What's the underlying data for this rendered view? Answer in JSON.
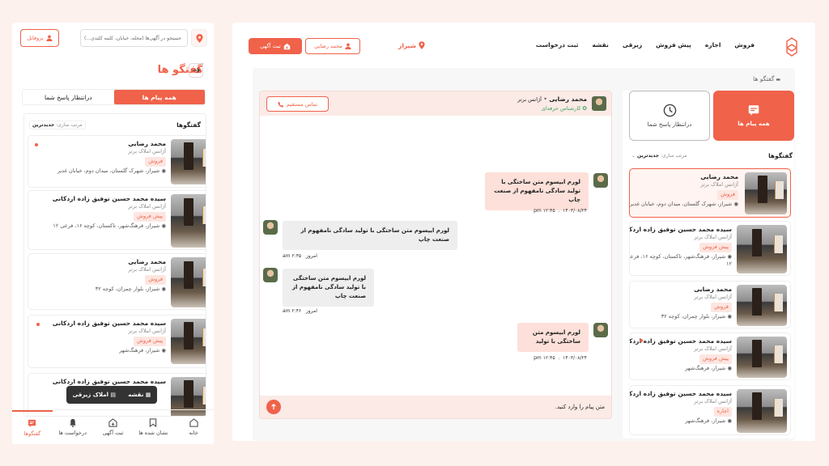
{
  "colors": {
    "accent": "#f0624a",
    "accent_soft": "#fde6e1"
  },
  "mobile": {
    "search_placeholder": "جستجو در آگهی‌ها (محله، خیابان، کلمه کلیدی...)",
    "profile_label": "پروفایل",
    "title": "گفتگو ها",
    "tabs": [
      {
        "label": "همه پیام ها"
      },
      {
        "label": "درانتظار پاسخ شما"
      }
    ],
    "list_title": "گفتگوها",
    "sort_label": "مرتب سازی:",
    "sort_value": "جدیدترین",
    "float_map": "نقشه",
    "float_zibaghi": "املاک زیرقی",
    "nav": [
      {
        "label": "خانه",
        "icon": "home-icon"
      },
      {
        "label": "نشان شده ها",
        "icon": "bookmark-icon"
      },
      {
        "label": "ثبت آگهی",
        "icon": "add-home-icon"
      },
      {
        "label": "درخواست ها",
        "icon": "bell-icon"
      },
      {
        "label": "گفتگوها",
        "icon": "chat-icon"
      }
    ]
  },
  "conversations": [
    {
      "name": "محمد رضایی",
      "agency": "آژانس املاک برتر",
      "tag": "فروش",
      "address": "شیراز، شهرک گلستان، میدان دوم، خیابان غدیر"
    },
    {
      "name": "سیده محمد حسین توفیق زاده اردکانی",
      "agency": "آژانس املاک برتر",
      "tag": "پیش فروش",
      "address": "شیراز، فرهنگ‌شهر، تاکستان، کوچه ۱۶، فرعی ۱۲"
    },
    {
      "name": "محمد رضایی",
      "agency": "آژانس املاک برتر",
      "tag": "فروش",
      "address": "شیراز، بلوار چمران، کوچه ۳۲"
    },
    {
      "name": "سیده محمد حسین توفیق زاده اردکانی",
      "agency": "آژانس املاک برتر",
      "tag": "پیش فروش",
      "address": "شیراز، فرهنگ‌شهر"
    },
    {
      "name": "سیده محمد حسین توفیق زاده اردکانی",
      "agency": "آژانس املاک برتر",
      "tag": "اجاره",
      "address": "شیراز، فرهنگ‌شهر"
    }
  ],
  "desktop": {
    "nav": [
      "فروش",
      "اجاره",
      "پیش فروش",
      "زیرقی",
      "نقشه",
      "ثبت درخواست"
    ],
    "city": "شیراز",
    "profile_label": "محمد رضایی",
    "post_ad_label": "ثبت آگهی",
    "breadcrumb": "گفتگو ها",
    "tab_all": "همه پیام ها",
    "tab_waiting": "درانتظار پاسخ شما",
    "list_title": "گفتگوها",
    "sort_label": "مرتب سازی:",
    "sort_value": "جدیدترین"
  },
  "chat": {
    "contact_name": "محمد رضایی",
    "contact_agency": "آژانس برتر",
    "contact_role": "کارشناس حرفه‌ای",
    "call_label": "تماس مستقیم",
    "input_placeholder": "متن پیام را وارد کنید.",
    "messages": [
      {
        "text": "لورم ایپسوم متن ساختگی با تولید سادگی نامفهوم از صنعت چاپ",
        "time": "۱۲:۴۵ pm",
        "date": "۱۴۰۳/۰۸/۲۴"
      },
      {
        "text": "لورم ایپسوم متن ساختگی با تولید سادگی نامفهوم از صنعت چاپ",
        "time": "۲:۴۵ am",
        "date": "امروز"
      },
      {
        "text": "لورم ایپسوم متن ساختگی با تولید سادگی نامفهوم از صنعت چاپ",
        "time": "۲:۴۶ am",
        "date": "امروز"
      },
      {
        "text": "لورم ایپسوم متن ساختگی با تولید",
        "time": "۱۲:۴۵ pm",
        "date": "۱۴۰۳/۰۸/۲۴"
      }
    ]
  }
}
